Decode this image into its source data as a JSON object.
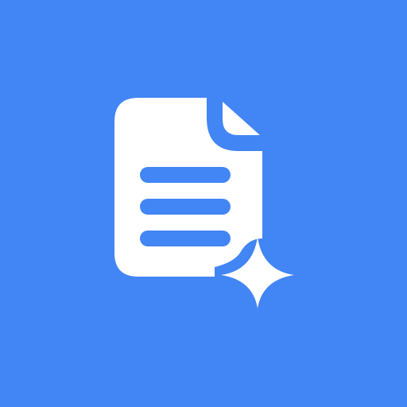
{
  "icon": {
    "name": "document-sparkle-icon",
    "background_color": "#4285F4",
    "glyph_color": "#FFFFFF"
  }
}
